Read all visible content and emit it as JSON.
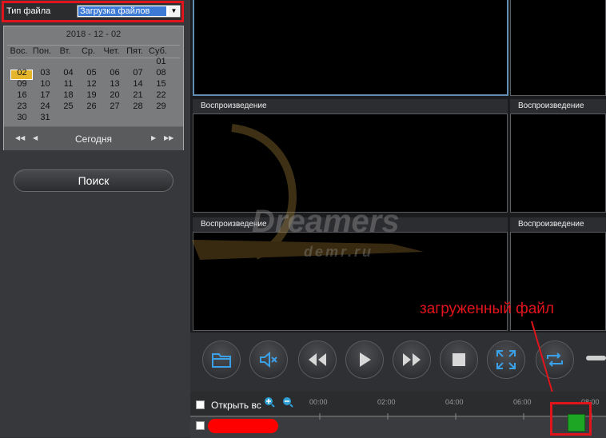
{
  "filetype": {
    "label": "Тип файла",
    "value": "Загрузка файлов"
  },
  "calendar": {
    "title": "2018 - 12 - 02",
    "weekdays": [
      "Вос.",
      "Пон.",
      "Вт.",
      "Ср.",
      "Чет.",
      "Пят.",
      "Суб."
    ],
    "selected_day": "02",
    "today_label": "Сегодня",
    "rows": [
      [
        "",
        "",
        "",
        "",
        "",
        "",
        "01"
      ],
      [
        "02",
        "03",
        "04",
        "05",
        "06",
        "07",
        "08"
      ],
      [
        "09",
        "10",
        "11",
        "12",
        "13",
        "14",
        "15"
      ],
      [
        "16",
        "17",
        "18",
        "19",
        "20",
        "21",
        "22"
      ],
      [
        "23",
        "24",
        "25",
        "26",
        "27",
        "28",
        "29"
      ],
      [
        "30",
        "31",
        "",
        "",
        "",
        "",
        ""
      ]
    ]
  },
  "search_label": "Поиск",
  "panes": {
    "title": "Воспроизведение"
  },
  "watermark": {
    "main": "Dreamers",
    "sub": "demr.ru"
  },
  "timeline": {
    "open_all_label": "Открыть вс",
    "ticks": [
      "00:00",
      "02:00",
      "04:00",
      "06:00",
      "08:00"
    ]
  },
  "annotation": {
    "text": "загруженный файл"
  },
  "colors": {
    "annotation": "#e2141b",
    "selected_day": "#e5b62b",
    "recorded_segment": "#1da524"
  },
  "icons": [
    "folder-icon",
    "mute-icon",
    "rewind-icon",
    "play-icon",
    "fast-forward-icon",
    "stop-icon",
    "fullscreen-icon",
    "repeat-icon",
    "zoom-in-icon",
    "zoom-out-icon"
  ]
}
